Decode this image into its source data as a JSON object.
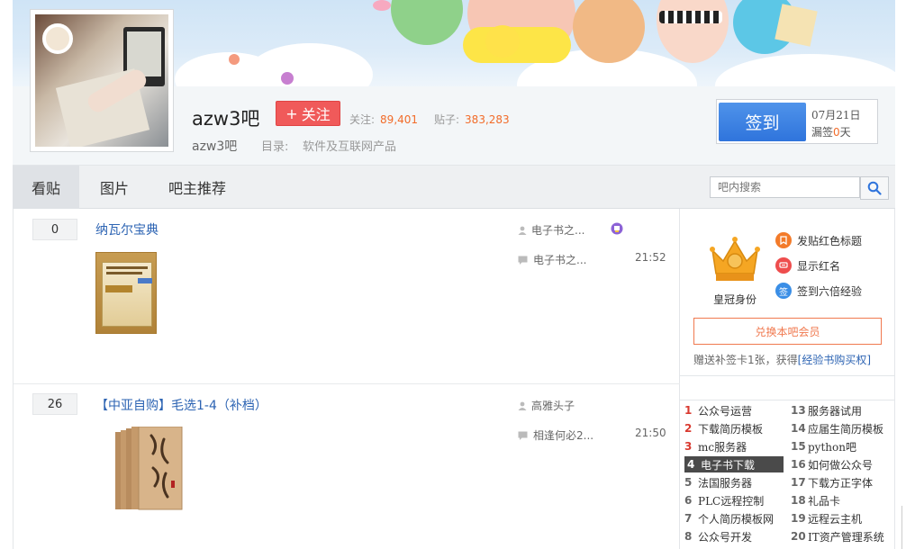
{
  "forum": {
    "name": "azw3吧",
    "sub_name": "azw3吧",
    "follow_label": "关注",
    "follow_plus": "+",
    "stats": {
      "followers_label": "关注:",
      "followers": "89,401",
      "posts_label": "贴子:",
      "posts": "383,283"
    },
    "directory_label": "目录:",
    "directory_value": "软件及互联网产品"
  },
  "signin": {
    "button_label": "签到",
    "date": "07月21日",
    "missed_prefix": "漏签",
    "missed_count": "0",
    "missed_suffix": "天"
  },
  "nav": {
    "tabs": [
      "看贴",
      "图片",
      "吧主推荐"
    ],
    "active_tab": "看贴",
    "search_placeholder": "吧内搜索"
  },
  "threads": [
    {
      "replies": "0",
      "title": "纳瓦尔宝典",
      "author": "电子书之...",
      "last_reply_user": "电子书之...",
      "last_reply_time": "21:52"
    },
    {
      "replies": "26",
      "title": "【中亚自购】毛选1-4（补档）",
      "author": "高雅头子",
      "last_reply_user": "相逢何必2...",
      "last_reply_time": "21:50"
    }
  ],
  "vip": {
    "crown_label": "皇冠身份",
    "perks": [
      {
        "label": "发贴红色标题",
        "color": "#f37b2a",
        "icon": "bookmark-icon"
      },
      {
        "label": "显示红名",
        "color": "#ee4d4d",
        "icon": "chat-bubble-icon"
      },
      {
        "label": "签到六倍经验",
        "color": "#3a8ee6",
        "icon": "sign-badge-icon",
        "glyph": "签"
      }
    ],
    "redeem_label": "兑换本吧会员",
    "gift_note": "赠送补签卡1张，获得",
    "gift_link": "[经验书购买权]"
  },
  "ranking": {
    "left": [
      {
        "no": "1",
        "name": "公众号运营"
      },
      {
        "no": "2",
        "name": "下载简历模板"
      },
      {
        "no": "3",
        "name": "mc服务器"
      },
      {
        "no": "4",
        "name": "电子书下载"
      },
      {
        "no": "5",
        "name": "法国服务器"
      },
      {
        "no": "6",
        "name": "PLC远程控制"
      },
      {
        "no": "7",
        "name": "个人简历模板网"
      },
      {
        "no": "8",
        "name": "公众号开发"
      }
    ],
    "right": [
      {
        "no": "13",
        "name": "服务器试用"
      },
      {
        "no": "14",
        "name": "应届生简历模板"
      },
      {
        "no": "15",
        "name": "python吧"
      },
      {
        "no": "16",
        "name": "如何做公众号"
      },
      {
        "no": "17",
        "name": "下载方正字体"
      },
      {
        "no": "18",
        "name": "礼品卡"
      },
      {
        "no": "19",
        "name": "远程云主机"
      },
      {
        "no": "20",
        "name": "IT资产管理系统"
      }
    ],
    "active_no": "4"
  },
  "colors": {
    "accent_orange": "#f26c2a",
    "follow_red": "#f05a5a",
    "link_blue": "#2d64b3",
    "sign_blue": "#3a7fe0"
  }
}
